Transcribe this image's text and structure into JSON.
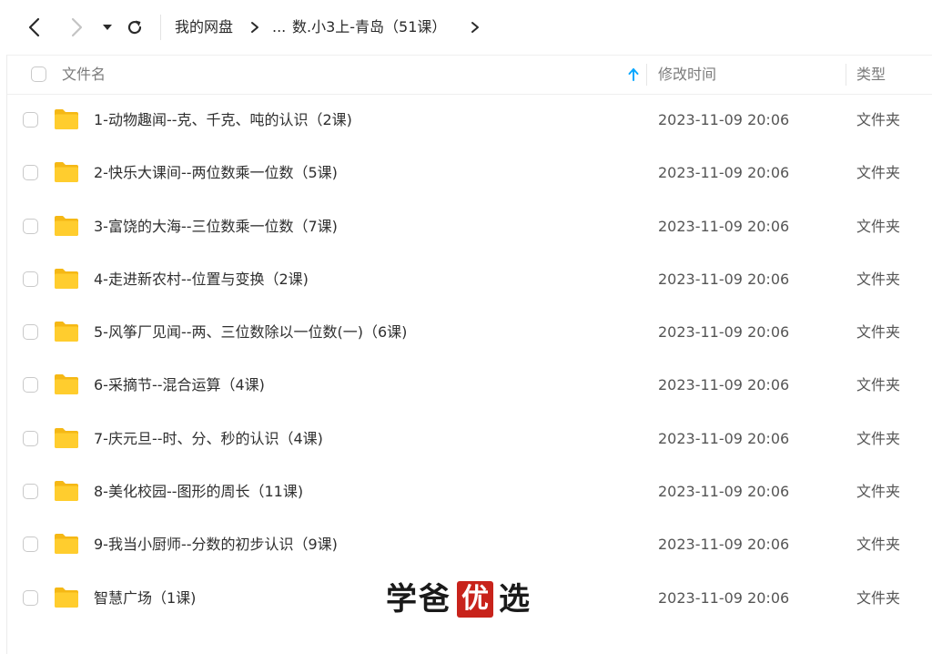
{
  "nav": {
    "back_icon": "chevron-left-icon",
    "forward_icon": "chevron-right-icon",
    "history_icon": "caret-down-icon",
    "refresh_icon": "refresh-icon"
  },
  "breadcrumb": {
    "root": "我的网盘",
    "ellipsis": "...",
    "current": "数.小3上-青岛（51课）"
  },
  "header": {
    "name_label": "文件名",
    "modified_label": "修改时间",
    "type_label": "类型",
    "sort_icon": "sort-ascending-arrow-icon"
  },
  "files": [
    {
      "name": "1-动物趣闻--克、千克、吨的认识（2课)",
      "modified": "2023-11-09 20:06",
      "type": "文件夹"
    },
    {
      "name": "2-快乐大课间--两位数乘一位数（5课)",
      "modified": "2023-11-09 20:06",
      "type": "文件夹"
    },
    {
      "name": "3-富饶的大海--三位数乘一位数（7课)",
      "modified": "2023-11-09 20:06",
      "type": "文件夹"
    },
    {
      "name": "4-走进新农村--位置与变换（2课)",
      "modified": "2023-11-09 20:06",
      "type": "文件夹"
    },
    {
      "name": "5-风筝厂见闻--两、三位数除以一位数(一)（6课)",
      "modified": "2023-11-09 20:06",
      "type": "文件夹"
    },
    {
      "name": "6-采摘节--混合运算（4课)",
      "modified": "2023-11-09 20:06",
      "type": "文件夹"
    },
    {
      "name": "7-庆元旦--时、分、秒的认识（4课)",
      "modified": "2023-11-09 20:06",
      "type": "文件夹"
    },
    {
      "name": "8-美化校园--图形的周长（11课)",
      "modified": "2023-11-09 20:06",
      "type": "文件夹"
    },
    {
      "name": "9-我当小厨师--分数的初步认识（9课)",
      "modified": "2023-11-09 20:06",
      "type": "文件夹"
    },
    {
      "name": "智慧广场（1课)",
      "modified": "2023-11-09 20:06",
      "type": "文件夹"
    }
  ],
  "watermark": {
    "char1": "学",
    "char2": "爸",
    "seal": "优",
    "char4": "选"
  },
  "colors": {
    "folder": "#FFCD2E",
    "folder_dark": "#F5B815",
    "accent": "#06A7FF",
    "seal": "#C8231B"
  }
}
